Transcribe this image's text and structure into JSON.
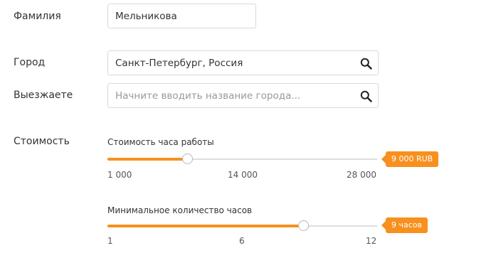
{
  "form": {
    "surname": {
      "label": "Фамилия",
      "value": "Мельникова"
    },
    "city": {
      "label": "Город",
      "value": "Санкт-Петербург, Россия"
    },
    "departure": {
      "label": "Выезжаете",
      "placeholder": "Начните вводить название города..."
    },
    "cost_label": "Стоимость"
  },
  "sliders": {
    "hourly": {
      "title": "Стоимость часа работы",
      "min_label": "1 000",
      "mid_label": "14 000",
      "max_label": "28 000",
      "min": 1000,
      "max": 28000,
      "value": 9000,
      "badge": "9 000 RUB"
    },
    "hours": {
      "title": "Минимальное количество часов",
      "min_label": "1",
      "mid_label": "6",
      "max_label": "12",
      "min": 1,
      "max": 12,
      "value": 9,
      "badge": "9 часов"
    }
  },
  "colors": {
    "accent": "#f7901e",
    "border": "#d9d9d9",
    "placeholder": "#999999"
  },
  "icons": {
    "search": "search-icon"
  }
}
